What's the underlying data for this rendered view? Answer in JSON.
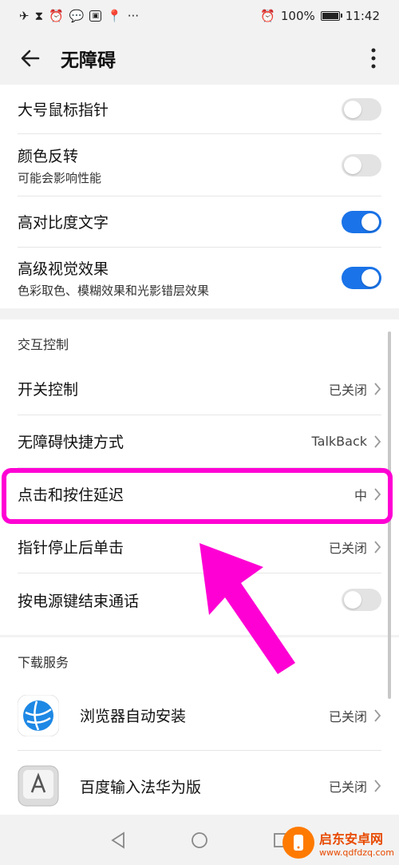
{
  "status": {
    "battery": "100%",
    "time": "11:42",
    "dots": "···",
    "battery_level": 1.0
  },
  "header": {
    "title": "无障碍"
  },
  "display_section": {
    "items": [
      {
        "label": "大号鼠标指针",
        "sub": "",
        "toggle": false
      },
      {
        "label": "颜色反转",
        "sub": "可能会影响性能",
        "toggle": false
      },
      {
        "label": "高对比度文字",
        "sub": "",
        "toggle": true
      },
      {
        "label": "高级视觉效果",
        "sub": "色彩取色、模糊效果和光影错层效果",
        "toggle": true
      }
    ]
  },
  "interaction_section": {
    "title": "交互控制",
    "items": [
      {
        "label": "开关控制",
        "value": "已关闭"
      },
      {
        "label": "无障碍快捷方式",
        "value": "TalkBack"
      },
      {
        "label": "点击和按住延迟",
        "value": "中"
      },
      {
        "label": "指针停止后单击",
        "value": "已关闭"
      },
      {
        "label": "按电源键结束通话",
        "toggle": false
      }
    ]
  },
  "download_section": {
    "title": "下载服务",
    "items": [
      {
        "label": "浏览器自动安装",
        "value": "已关闭",
        "icon": "browser-globe-icon"
      },
      {
        "label": "百度输入法华为版",
        "value": "已关闭",
        "icon": "keyboard-a-icon"
      }
    ]
  },
  "watermark": {
    "title": "启东安卓网",
    "url": "www.qdfdzq.com"
  },
  "colors": {
    "accent": "#1a73e8",
    "highlight": "#ff00d4",
    "watermark": "#ff7a00"
  }
}
